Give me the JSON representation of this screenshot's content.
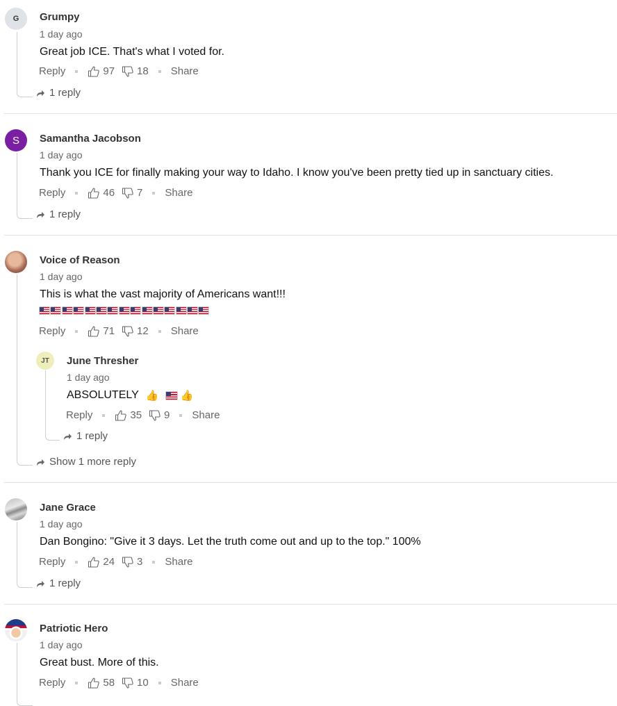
{
  "labels": {
    "reply": "Reply",
    "share": "Share"
  },
  "comments": [
    {
      "author": "Grumpy",
      "initials": "G",
      "time": "1 day ago",
      "text": "Great job ICE. That's what I voted for.",
      "likes": "97",
      "dislikes": "18",
      "replies": "1 reply"
    },
    {
      "author": "Samantha Jacobson",
      "initials": "S",
      "time": "1 day ago",
      "text": "Thank you ICE for finally making your way to Idaho. I know you've been pretty tied up in sanctuary cities.",
      "likes": "46",
      "dislikes": "7",
      "replies": "1 reply"
    },
    {
      "author": "Voice of Reason",
      "time": "1 day ago",
      "text": "This is what the vast majority of Americans want!!!",
      "flag_count": 15,
      "likes": "71",
      "dislikes": "12",
      "more_replies": "Show 1 more reply",
      "reply": {
        "author": "June Thresher",
        "initials": "JT",
        "time": "1 day ago",
        "text": "ABSOLUTELY",
        "likes": "35",
        "dislikes": "9",
        "replies": "1 reply"
      }
    },
    {
      "author": "Jane Grace",
      "time": "1 day ago",
      "text": "Dan Bongino: \"Give it 3 days. Let the truth come out and up to the top.\" 100%",
      "likes": "24",
      "dislikes": "3",
      "replies": "1 reply"
    },
    {
      "author": "Patriotic Hero",
      "time": "1 day ago",
      "text": "Great bust. More of this.",
      "likes": "58",
      "dislikes": "10"
    }
  ],
  "colors": {
    "accent_purple": "#7b1fa2",
    "divider": "#e2e2e2"
  },
  "icons": {
    "like": "thumbs-up-icon",
    "dislike": "thumbs-down-icon",
    "reply_arrow": "reply-arrow-icon"
  }
}
